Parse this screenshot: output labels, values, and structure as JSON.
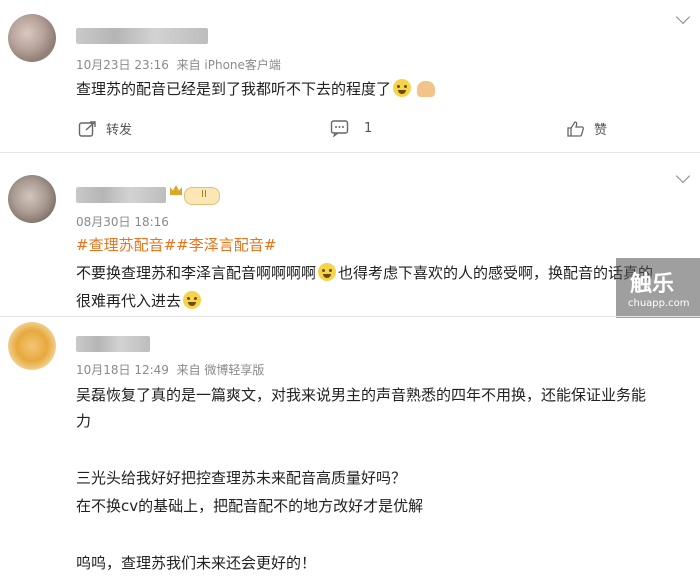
{
  "comments": [
    {
      "time": "10月23日 23:16",
      "source": "来自 iPhone客户端",
      "text": "查理苏的配音已经是到了我都听不下去的程度了",
      "actions": {
        "repost": "转发",
        "comment_count": "1",
        "like": "赞"
      }
    },
    {
      "time": "08月30日 18:16",
      "badge": "II",
      "tags": "#查理苏配音##李泽言配音#",
      "lines": [
        "不要换查理苏和李泽言配音啊啊啊啊",
        "也得考虑下喜欢的人的感受啊，换配音的话真的",
        "很难再代入进去"
      ]
    },
    {
      "time": "10月18日 12:49",
      "source": "来自 微博轻享版",
      "lines": [
        "吴磊恢复了真的是一篇爽文，对我来说男主的声音熟悉的四年不用换，还能保证业务能",
        "力",
        "三光头给我好好把控查理苏未来配音高质量好吗？",
        "在不换cv的基础上，把配音配不的地方改好才是优解",
        "呜呜，查理苏我们未来还会更好的！"
      ]
    }
  ],
  "watermark": {
    "logo": "触乐",
    "site": "chuapp.com"
  }
}
